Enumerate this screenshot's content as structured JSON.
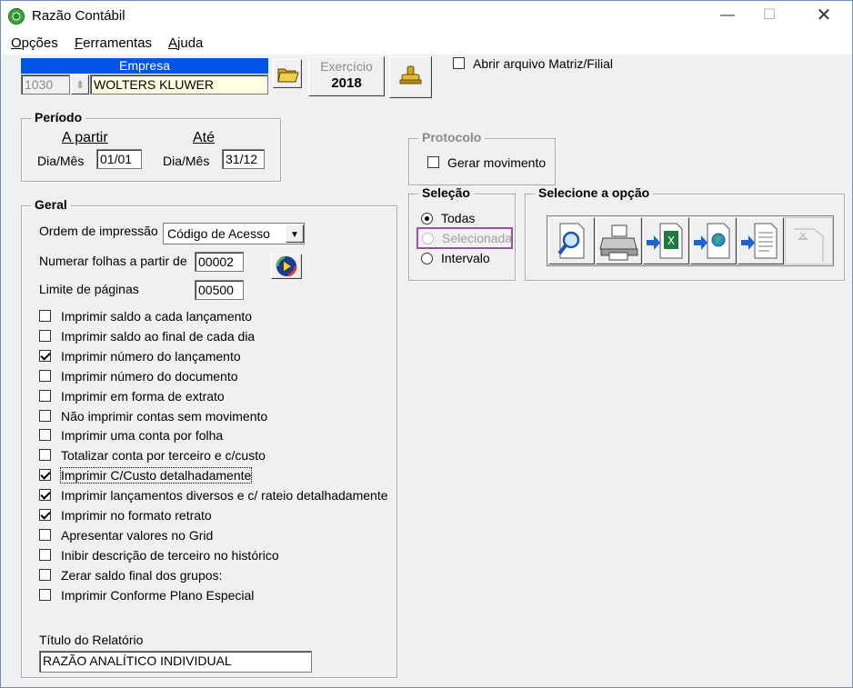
{
  "window": {
    "title": "Razão Contábil",
    "minimize": "—",
    "maximize": "☐",
    "close": "✕"
  },
  "menu": [
    {
      "accel": "O",
      "rest": "pções"
    },
    {
      "accel": "F",
      "rest": "erramentas"
    },
    {
      "accel": "A",
      "rest": "juda"
    }
  ],
  "empresa": {
    "header": "Empresa",
    "code": "1030",
    "name": "WOLTERS KLUWER",
    "exercicio_label": "Exercício",
    "exercicio_value": "2018"
  },
  "abrir_matriz": {
    "label": "Abrir arquivo Matriz/Filial",
    "checked": false
  },
  "periodo": {
    "title": "Período",
    "from_header": "A partir",
    "to_header": "Até",
    "from_label": "Dia/Mês",
    "from_value": "01/01",
    "to_label": "Dia/Mês",
    "to_value": "31/12"
  },
  "protocolo": {
    "title": "Protocolo",
    "gerar_label": "Gerar movimento"
  },
  "selecao": {
    "title": "Seleção",
    "options": [
      {
        "label": "Todas",
        "checked": true,
        "disabled": false
      },
      {
        "label": "Selecionada",
        "checked": false,
        "disabled": true
      },
      {
        "label": "Intervalo",
        "checked": false,
        "disabled": false
      }
    ],
    "highlight_color": "#9b4fa8"
  },
  "opcao": {
    "title": "Selecione a opção",
    "icons": [
      "preview-icon",
      "printer-icon",
      "export-excel-icon",
      "export-html-icon",
      "export-text-icon",
      "disabled-export-icon"
    ]
  },
  "geral": {
    "title": "Geral",
    "ordem_label": "Ordem de impressão",
    "ordem_value": "Código de Acesso",
    "numerar_label": "Numerar folhas a partir de",
    "numerar_value": "00002",
    "limite_label": "Limite de páginas",
    "limite_value": "00500",
    "options": [
      {
        "label": "Imprimir saldo a cada lançamento",
        "checked": false
      },
      {
        "label": "Imprimir saldo ao final de cada dia",
        "checked": false
      },
      {
        "label": "Imprimir número do lançamento",
        "checked": true
      },
      {
        "label": "Imprimir número do documento",
        "checked": false
      },
      {
        "label": "Imprimir em forma de extrato",
        "checked": false
      },
      {
        "label": "Não imprimir contas sem movimento",
        "checked": false
      },
      {
        "label": "Imprimir uma conta por folha",
        "checked": false
      },
      {
        "label": "Totalizar conta por terceiro e c/custo",
        "checked": false
      },
      {
        "label": "Imprimir C/Custo detalhadamente",
        "checked": true
      },
      {
        "label": "Imprimir lançamentos diversos e c/ rateio detalhadamente",
        "checked": true
      },
      {
        "label": "Imprimir no formato retrato",
        "checked": true
      },
      {
        "label": "Apresentar valores no Grid",
        "checked": false
      },
      {
        "label": "Inibir descrição de terceiro no histórico",
        "checked": false
      },
      {
        "label": "Zerar saldo final dos grupos:",
        "checked": false
      },
      {
        "label": "Imprimir Conforme Plano Especial",
        "checked": false
      }
    ],
    "titulo_label": "Título do Relatório",
    "titulo_value": "RAZÃO ANALÍTICO INDIVIDUAL"
  }
}
